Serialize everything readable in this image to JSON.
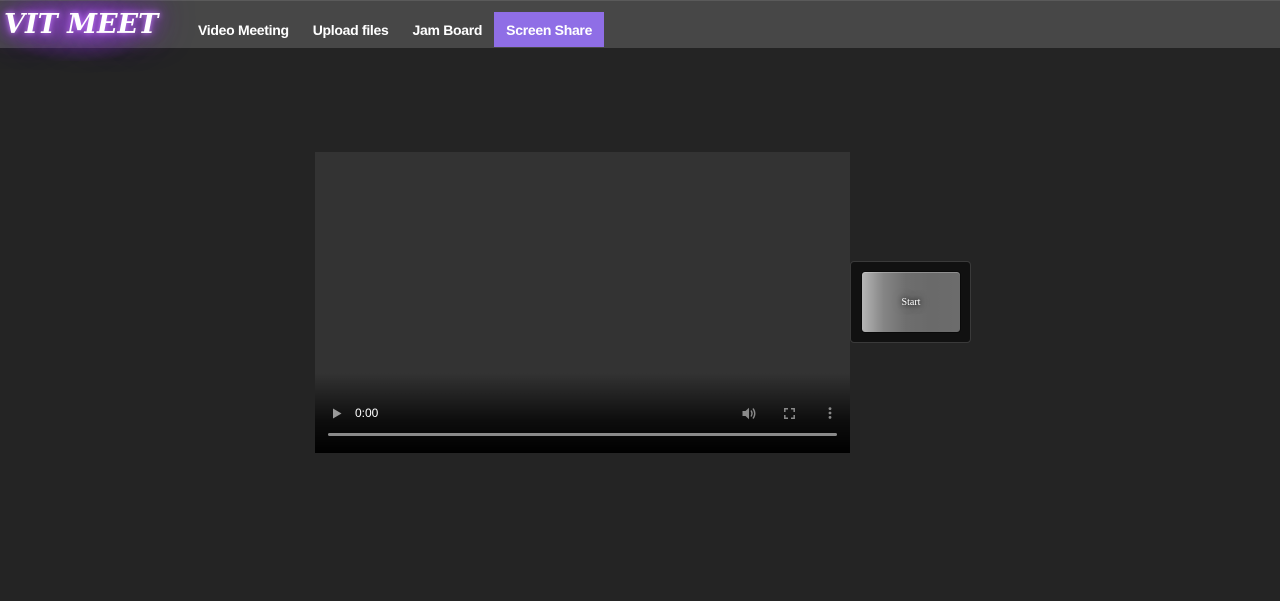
{
  "navbar": {
    "logo_text": "VIT MEET",
    "links": [
      {
        "label": "Video Meeting",
        "active": false
      },
      {
        "label": "Upload files",
        "active": false
      },
      {
        "label": "Jam Board",
        "active": false
      },
      {
        "label": "Screen Share",
        "active": true
      }
    ]
  },
  "video": {
    "current_time": "0:00",
    "progress": 0
  },
  "start_button": {
    "label": "Start"
  },
  "colors": {
    "background": "#242424",
    "navbar": "#474747",
    "active_tab": "#8f6ee6",
    "logo_glow": "#9d4edd"
  },
  "icons": {
    "play": "play-icon",
    "volume": "volume-icon",
    "fullscreen": "fullscreen-icon",
    "more": "more-vertical-icon"
  }
}
